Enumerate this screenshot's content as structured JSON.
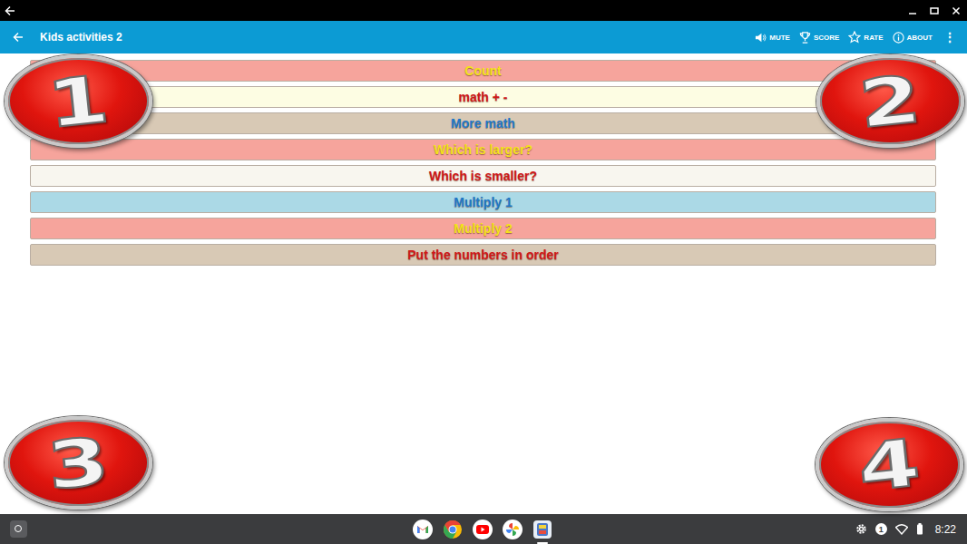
{
  "app_bar": {
    "title": "Kids activities 2",
    "actions": [
      {
        "label": "MUTE"
      },
      {
        "label": "SCORE"
      },
      {
        "label": "RATE"
      },
      {
        "label": "ABOUT"
      }
    ],
    "more": "⋮"
  },
  "menu": {
    "items": [
      {
        "label": "Count",
        "color": "#f6a49c",
        "text_color": "#f5e21a"
      },
      {
        "label": "math + -",
        "color": "#fdfde3",
        "text_color": "#d01818"
      },
      {
        "label": "More math",
        "color": "#d8c9b5",
        "text_color": "#1e78c8"
      },
      {
        "label": "Which is larger?",
        "color": "#f6a49c",
        "text_color": "#f5e21a"
      },
      {
        "label": "Which is smaller?",
        "color": "#f8f6ef",
        "text_color": "#d01818"
      },
      {
        "label": "Multiply 1",
        "color": "#abd9e6",
        "text_color": "#1e78c8"
      },
      {
        "label": "Multiply 2",
        "color": "#f6a49c",
        "text_color": "#f5e21a"
      },
      {
        "label": "Put the numbers in order",
        "color": "#d8c9b5",
        "text_color": "#d01818"
      }
    ]
  },
  "badges": [
    {
      "label": "1"
    },
    {
      "label": "2"
    },
    {
      "label": "3"
    },
    {
      "label": "4"
    }
  ],
  "taskbar": {
    "notifications": "1",
    "time": "8:22"
  }
}
